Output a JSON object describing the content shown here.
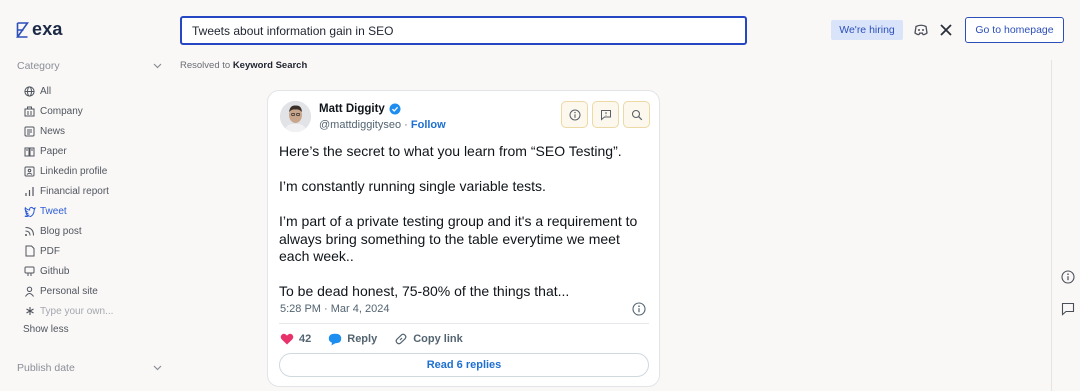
{
  "header": {
    "logo_text": "exa",
    "search_value": "Tweets about information gain in SEO",
    "hiring_label": "We're hiring",
    "discord_icon": "discord-icon",
    "x_icon": "x-icon",
    "homepage_label": "Go to homepage"
  },
  "sidebar": {
    "category_label": "Category",
    "items": [
      {
        "label": "All",
        "icon": "globe-icon"
      },
      {
        "label": "Company",
        "icon": "building-icon"
      },
      {
        "label": "News",
        "icon": "newspaper-icon"
      },
      {
        "label": "Paper",
        "icon": "book-icon"
      },
      {
        "label": "Linkedin profile",
        "icon": "id-card-icon"
      },
      {
        "label": "Financial report",
        "icon": "bar-chart-icon"
      },
      {
        "label": "Tweet",
        "icon": "bird-icon"
      },
      {
        "label": "Blog post",
        "icon": "rss-icon"
      },
      {
        "label": "PDF",
        "icon": "file-icon"
      },
      {
        "label": "Github",
        "icon": "git-icon"
      },
      {
        "label": "Personal site",
        "icon": "person-icon"
      },
      {
        "label": "Type your own...",
        "icon": "asterisk-icon"
      }
    ],
    "show_less": "Show less",
    "publish_label": "Publish date"
  },
  "results": {
    "resolved_prefix": "Resolved to ",
    "resolved_mode": "Keyword Search"
  },
  "tweet": {
    "name": "Matt Diggity",
    "handle": "@mattdiggityseo",
    "separator": " · ",
    "follow": "Follow",
    "body": [
      "Here’s the secret to what you learn from “SEO Testing”.",
      "I’m constantly running single variable tests.",
      "I’m part of a private testing group and it's a requirement to always bring something to the table everytime we meet each week..",
      "To be dead honest, 75-80% of the things that..."
    ],
    "date": "5:28 PM · Mar 4, 2024",
    "likes": "42",
    "reply": "Reply",
    "copy_link": "Copy link",
    "read_replies": "Read 6 replies"
  },
  "colors": {
    "accent": "#2c4fb8",
    "active": "#2c5cd6",
    "like": "#e8326c",
    "background": "#f9f8f6"
  }
}
